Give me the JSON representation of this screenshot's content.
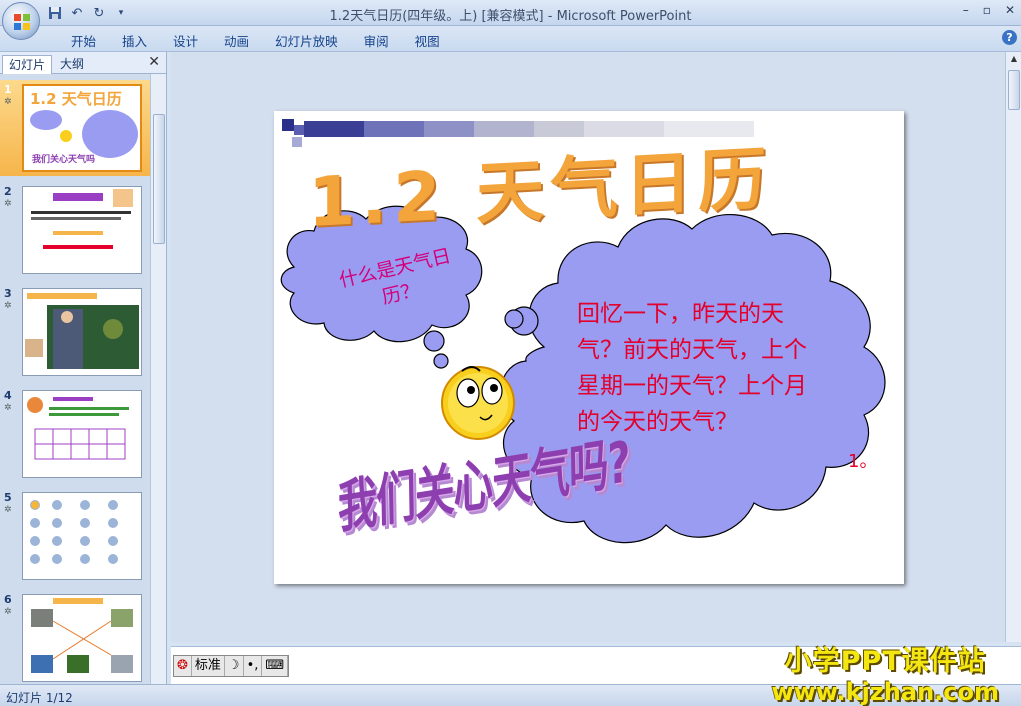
{
  "window": {
    "title": "1.2天气日历(四年级。上) [兼容模式] - Microsoft PowerPoint"
  },
  "ribbon": {
    "tabs": [
      "开始",
      "插入",
      "设计",
      "动画",
      "幻灯片放映",
      "审阅",
      "视图"
    ]
  },
  "left_panel": {
    "tabs": [
      "幻灯片",
      "大纲"
    ],
    "slides": [
      {
        "number": "1",
        "selected": true
      },
      {
        "number": "2",
        "selected": false
      },
      {
        "number": "3",
        "selected": false
      },
      {
        "number": "4",
        "selected": false
      },
      {
        "number": "5",
        "selected": false
      },
      {
        "number": "6",
        "selected": false
      }
    ]
  },
  "slide": {
    "title": "1.2 天气日历",
    "small_cloud_text": "什么是天气日历？",
    "big_cloud_text": "回忆一下，昨天的天气？前天的天气，上个星期一的天气？上个月的今天的天气？",
    "wordart": "我们关心天气吗?",
    "trailing_text": "1。"
  },
  "ime_bar": {
    "mode": "标准"
  },
  "status": {
    "slide_indicator": "幻灯片 1/12"
  },
  "watermark": {
    "line1": "小学PPT课件站",
    "line2": "www.kjzhan.com"
  },
  "colors": {
    "cloud_fill": "#9a9cf2",
    "title_orange": "#f3a43a",
    "cloud_text_red": "#e4002b",
    "selected_thumb": "#f6b54b"
  }
}
